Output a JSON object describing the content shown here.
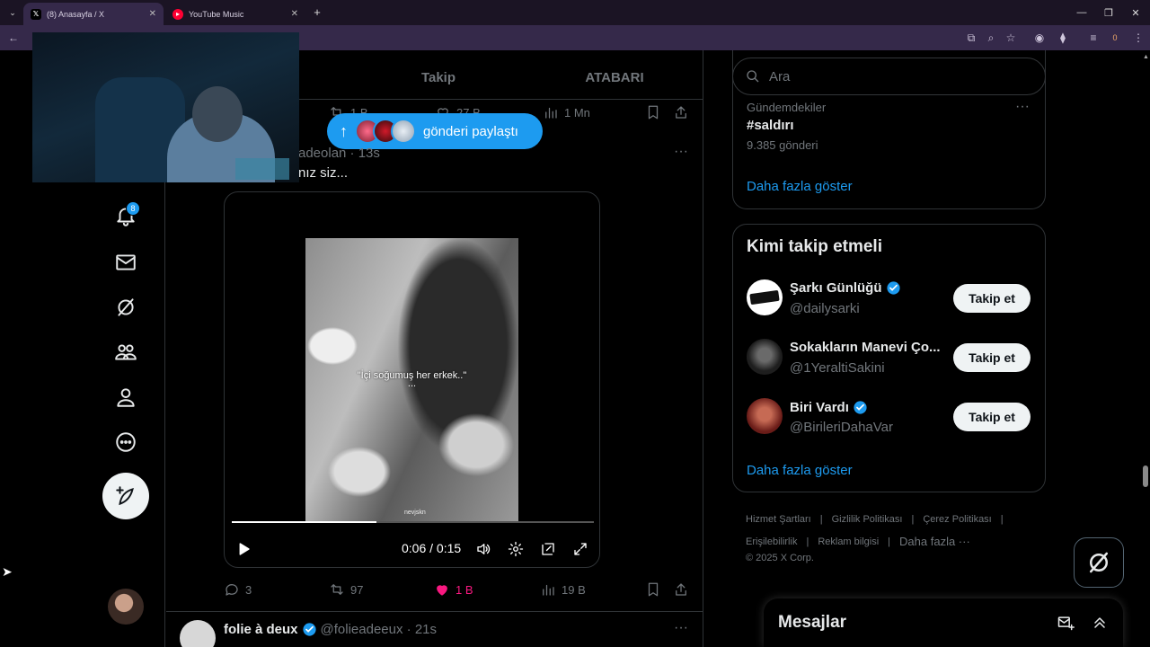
{
  "browser": {
    "tabs": [
      {
        "title": "(8) Anasayfa / X",
        "favicon": "x-logo-icon",
        "active": true
      },
      {
        "title": "YouTube Music",
        "favicon": "youtube-music-icon",
        "active": false
      }
    ],
    "new_tab": "+",
    "profile_badge": "0"
  },
  "main": {
    "tabs": [
      "Takip",
      "ATABARI"
    ],
    "prev_post": {
      "retweets": "1 B",
      "likes": "27 B",
      "views": "1 Mn"
    },
    "new_posts_pill": {
      "label": "gönderi paylaştı"
    },
    "post": {
      "handle_time": "adeolan · 13s",
      "text": "nız siz...",
      "video": {
        "caption": "\"İçi soğumuş her erkek..\"",
        "caption_dots": "...",
        "watermark": "nevjskn",
        "progress": 0.4,
        "time": "0:06 / 0:15"
      },
      "stats": {
        "replies": "3",
        "retweets": "97",
        "likes": "1 B",
        "views": "19 B"
      },
      "like_color": "#f91880"
    },
    "next_post": {
      "name": "folie à deux",
      "handle_time": "@folieadeeux · 21s"
    }
  },
  "leftnav": {
    "notification_count": "8"
  },
  "right": {
    "search": {
      "placeholder": "Ara"
    },
    "trends": {
      "context": "Gündemdekiler",
      "topic": "#saldırı",
      "count": "9.385 gönderi",
      "show_more": "Daha fazla göster"
    },
    "who_to_follow": {
      "title": "Kimi takip etmeli",
      "users": [
        {
          "name": "Şarkı Günlüğü",
          "handle": "@dailysarki",
          "verified": true,
          "button": "Takip et"
        },
        {
          "name": "Sokakların Manevi Ço...",
          "handle": "@1YeraltiSakini",
          "verified": false,
          "button": "Takip et"
        },
        {
          "name": "Biri Vardı",
          "handle": "@BirileriDahaVar",
          "verified": true,
          "button": "Takip et"
        }
      ],
      "show_more": "Daha fazla göster"
    },
    "footer": {
      "links": [
        "Hizmet Şartları",
        "Gizlilik Politikası",
        "Çerez Politikası",
        "Erişilebilirlik",
        "Reklam bilgisi",
        "Daha fazla ···"
      ],
      "copyright": "© 2025 X Corp."
    },
    "messages": {
      "title": "Mesajlar"
    }
  },
  "colors": {
    "accent": "#1d9bf0",
    "like": "#f91880",
    "border": "#2f3336"
  }
}
